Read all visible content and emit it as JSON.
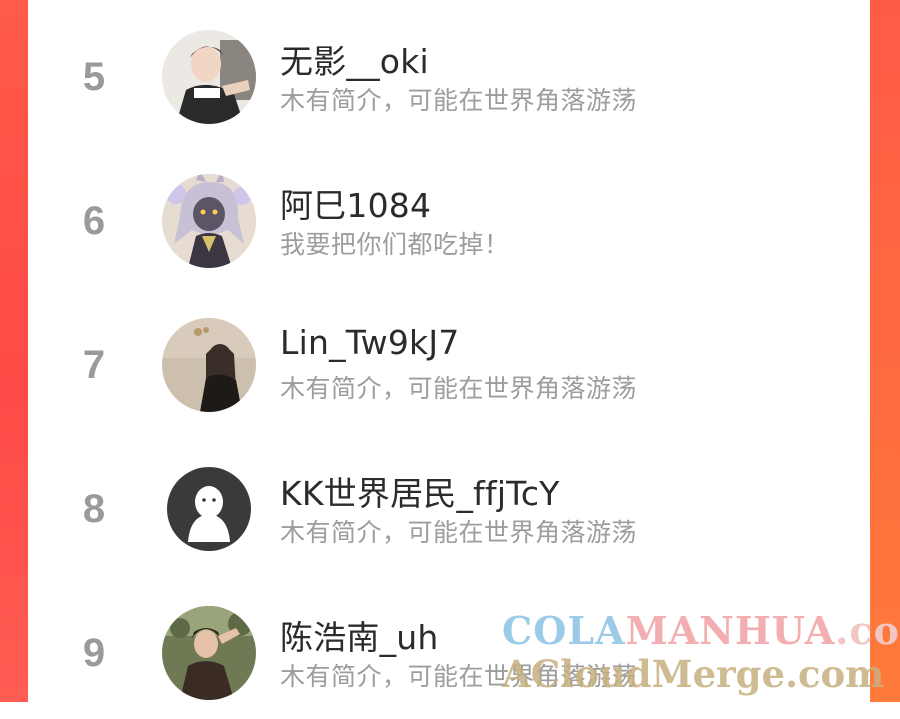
{
  "users": [
    {
      "rank": "5",
      "name": "无影__oki",
      "bio": "木有简介，可能在世界角落游荡",
      "avatar_icon": "photo-avatar-icon"
    },
    {
      "rank": "6",
      "name": "阿巳1084",
      "bio": "我要把你们都吃掉！",
      "avatar_icon": "anime-avatar-icon"
    },
    {
      "rank": "7",
      "name": "Lin_Tw9kJ7",
      "bio": "木有简介，可能在世界角落游荡",
      "avatar_icon": "photo-avatar-icon"
    },
    {
      "rank": "8",
      "name": "KK世界居民_ffjTcY",
      "bio": "木有简介，可能在世界角落游荡",
      "avatar_icon": "default-avatar-icon"
    },
    {
      "rank": "9",
      "name": "陈浩南_uh",
      "bio": "木有简介，可能在世界角落游荡",
      "avatar_icon": "photo-avatar-icon"
    }
  ],
  "watermark": {
    "line1_a": "COLA",
    "line1_b": "MANHUA",
    "line1_c": ".com",
    "line2": "ACloudMerge.com"
  },
  "colors": {
    "edge_red": "#ff4b47",
    "edge_orange": "#ff7b3a",
    "rank_gray": "#9a9a9a",
    "name_text": "#2b2b2b",
    "bio_text": "#9d9d9d"
  }
}
